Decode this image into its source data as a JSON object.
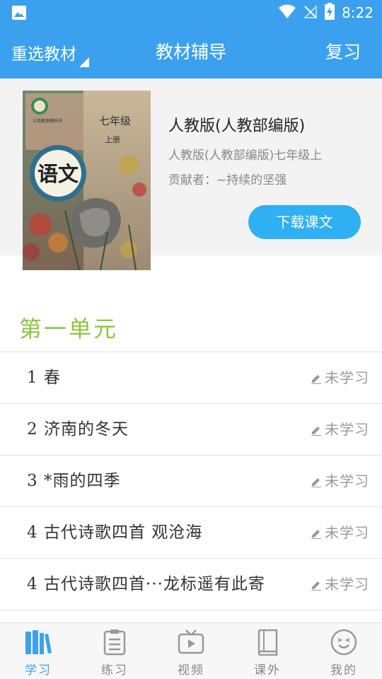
{
  "status_bar": {
    "time": "8:22",
    "icons": [
      "image-icon",
      "wifi-icon",
      "no-signal-icon",
      "battery-charging-icon"
    ]
  },
  "header": {
    "left_label": "重选教材",
    "title": "教材辅导",
    "right_label": "复习"
  },
  "book": {
    "title": "人教版(人教部编版)",
    "subtitle": "人教版(人教部编版)七年级上",
    "contributor": "贡献者：~持续的坚强",
    "download_label": "下载课文",
    "cover": {
      "grade": "七年级",
      "volume": "上册",
      "subject": "语文",
      "series": "义务教育教科书"
    }
  },
  "unit": {
    "title": "第一单元"
  },
  "lessons": [
    {
      "name": "1 春",
      "status": "未学习"
    },
    {
      "name": "2 济南的冬天",
      "status": "未学习"
    },
    {
      "name": "3 *雨的四季",
      "status": "未学习"
    },
    {
      "name": "4 古代诗歌四首 观沧海",
      "status": "未学习"
    },
    {
      "name": "4 古代诗歌四首···龙标遥有此寄",
      "status": "未学习"
    }
  ],
  "bottom_nav": {
    "items": [
      {
        "label": "学习",
        "icon": "books-icon",
        "active": true
      },
      {
        "label": "练习",
        "icon": "clipboard-icon",
        "active": false
      },
      {
        "label": "视频",
        "icon": "tv-play-icon",
        "active": false
      },
      {
        "label": "课外",
        "icon": "book-icon",
        "active": false
      },
      {
        "label": "我的",
        "icon": "smiley-face-icon",
        "active": false
      }
    ]
  },
  "colors": {
    "primary": "#3ba1ef",
    "download_button": "#2fb0f3",
    "unit_title": "#8dc63f",
    "muted_text": "#9a9a9a"
  }
}
